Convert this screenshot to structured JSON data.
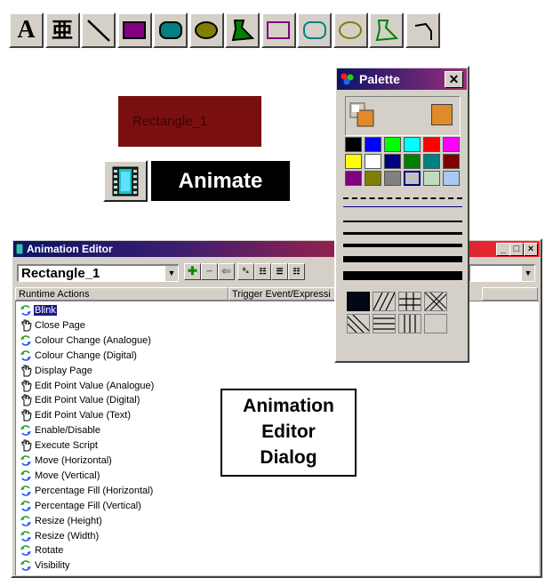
{
  "toolbar": {
    "tools": [
      {
        "name": "text-tool-icon",
        "glyph": "A"
      },
      {
        "name": "text-style-tool-icon",
        "glyph": "亜"
      },
      {
        "name": "line-tool-icon"
      },
      {
        "name": "filled-rectangle-tool-icon",
        "color": "#800080"
      },
      {
        "name": "filled-rounded-rectangle-tool-icon",
        "color": "#008080"
      },
      {
        "name": "filled-ellipse-tool-icon",
        "color": "#808000"
      },
      {
        "name": "filled-polygon-tool-icon",
        "color": "#008000"
      },
      {
        "name": "rectangle-outline-tool-icon",
        "color": "#800080"
      },
      {
        "name": "rounded-rectangle-outline-tool-icon",
        "color": "#008080"
      },
      {
        "name": "ellipse-outline-tool-icon",
        "color": "#808000"
      },
      {
        "name": "polygon-outline-tool-icon",
        "color": "#008000"
      },
      {
        "name": "polyline-tool-icon"
      }
    ]
  },
  "canvas": {
    "rectangle_label": "Rectangle_1",
    "rectangle_color": "#7a0f0f",
    "animate_label": "Animate"
  },
  "palette": {
    "title": "Palette",
    "close_glyph": "✕",
    "swatches": [
      "#000000",
      "#0000ff",
      "#00ff00",
      "#00ffff",
      "#ff0000",
      "#ff00ff",
      "#ffff00",
      "#ffffff",
      "#000080",
      "#008000",
      "#008080",
      "#800000",
      "#800080",
      "#808000",
      "#808080",
      "#c0c0c0",
      "#c0dcc0",
      "#a6caf0"
    ]
  },
  "editor": {
    "title": "Animation Editor",
    "object_selected": "Rectangle_1",
    "columns": {
      "actions": "Runtime Actions",
      "trigger": "Trigger Event/Expressi"
    },
    "actions": [
      {
        "label": "Blink",
        "icon": "animate-icon",
        "selected": true
      },
      {
        "label": "Close Page",
        "icon": "hand-icon"
      },
      {
        "label": "Colour Change (Analogue)",
        "icon": "animate-icon"
      },
      {
        "label": "Colour Change (Digital)",
        "icon": "animate-icon"
      },
      {
        "label": "Display Page",
        "icon": "hand-icon"
      },
      {
        "label": "Edit Point Value (Analogue)",
        "icon": "hand-icon"
      },
      {
        "label": "Edit Point Value (Digital)",
        "icon": "hand-icon"
      },
      {
        "label": "Edit Point Value (Text)",
        "icon": "hand-icon"
      },
      {
        "label": "Enable/Disable",
        "icon": "animate-icon"
      },
      {
        "label": "Execute Script",
        "icon": "hand-icon"
      },
      {
        "label": "Move (Horizontal)",
        "icon": "animate-icon"
      },
      {
        "label": "Move (Vertical)",
        "icon": "animate-icon"
      },
      {
        "label": "Percentage Fill (Horizontal)",
        "icon": "animate-icon"
      },
      {
        "label": "Percentage Fill (Vertical)",
        "icon": "animate-icon"
      },
      {
        "label": "Resize (Height)",
        "icon": "animate-icon"
      },
      {
        "label": "Resize (Width)",
        "icon": "animate-icon"
      },
      {
        "label": "Rotate",
        "icon": "animate-icon"
      },
      {
        "label": "Visibility",
        "icon": "animate-icon"
      }
    ]
  },
  "caption": {
    "line1": "Animation",
    "line2": "Editor",
    "line3": "Dialog"
  }
}
